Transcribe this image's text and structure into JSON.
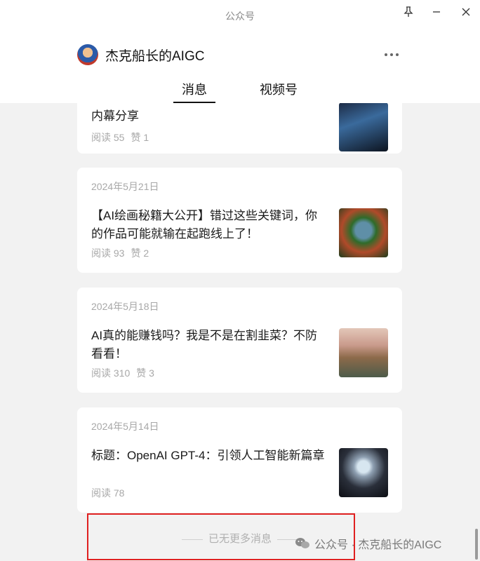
{
  "window": {
    "title": "公众号"
  },
  "account": {
    "name": "杰克船长的AIGC"
  },
  "tabs": [
    {
      "label": "消息"
    },
    {
      "label": "视频号"
    }
  ],
  "articles": [
    {
      "date": "",
      "title": "内幕分享",
      "reads": "阅读 55",
      "likes": "赞 1"
    },
    {
      "date": "2024年5月21日",
      "title": "【AI绘画秘籍大公开】错过这些关键词，你的作品可能就输在起跑线上了！",
      "reads": "阅读 93",
      "likes": "赞 2"
    },
    {
      "date": "2024年5月18日",
      "title": "AI真的能赚钱吗？我是不是在割韭菜？不防看看！",
      "reads": "阅读 310",
      "likes": "赞 3"
    },
    {
      "date": "2024年5月14日",
      "title": "标题：OpenAI GPT-4：引领人工智能新篇章",
      "reads": "阅读 78",
      "likes": ""
    }
  ],
  "footer": {
    "end_text": "已无更多消息",
    "watermark": "公众号 · 杰克船长的AIGC"
  },
  "icons": {
    "pin": "pin-icon",
    "minimize": "minimize-icon",
    "close": "close-icon",
    "more": "more-icon",
    "wechat": "wechat-icon"
  },
  "colors": {
    "highlight": "#e02020",
    "background": "#f2f2f2",
    "card": "#ffffff"
  }
}
